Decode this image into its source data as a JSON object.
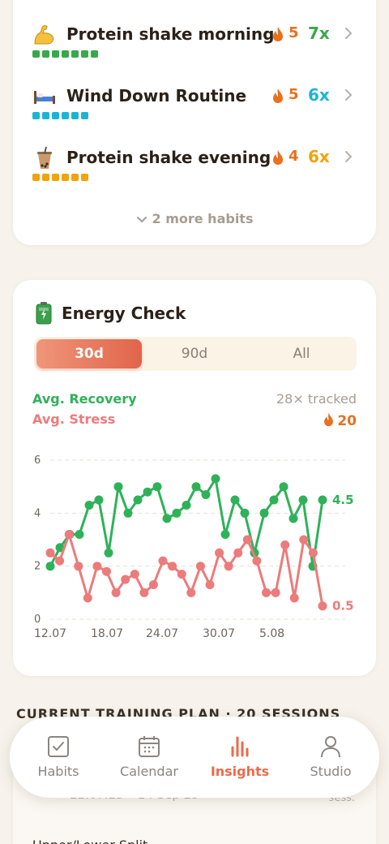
{
  "habits": [
    {
      "emoji": "flexed-biceps-icon",
      "title": "Protein shake morning",
      "streak": "5",
      "count": "7x",
      "color": "#37a94a",
      "dots": 7
    },
    {
      "emoji": "bed-icon",
      "title": "Wind Down Routine",
      "streak": "5",
      "count": "6x",
      "color": "#1ab5d6",
      "dots": 6
    },
    {
      "emoji": "bubble-tea-icon",
      "title": "Protein shake evening",
      "streak": "4",
      "count": "6x",
      "color": "#f2a20a",
      "dots": 6
    }
  ],
  "more_habits": "2 more habits",
  "energy": {
    "icon": "battery-icon",
    "title": "Energy Check",
    "tabs": [
      "30d",
      "90d",
      "All"
    ],
    "active_tab": "30d",
    "recovery_label": "Avg. Recovery",
    "stress_label": "Avg. Stress",
    "tracked": "28× tracked",
    "stress_streak": "20"
  },
  "chart_data": {
    "type": "line",
    "ylim": [
      0,
      6
    ],
    "yticks": [
      "0",
      "2",
      "4",
      "6"
    ],
    "xticks": [
      "12.07",
      "18.07",
      "24.07",
      "30.07",
      "5.08"
    ],
    "grid": true,
    "series": [
      {
        "name": "Avg. Recovery",
        "color": "#2fb15a",
        "end_label": "4.5",
        "values": [
          2.0,
          2.7,
          3.2,
          3.2,
          4.3,
          4.5,
          2.5,
          5.0,
          4.0,
          4.5,
          4.8,
          5.0,
          3.8,
          4.0,
          4.3,
          5.0,
          4.7,
          5.3,
          3.2,
          4.5,
          4.0,
          2.5,
          4.0,
          4.5,
          5.0,
          3.8,
          4.5,
          2.0,
          4.5
        ]
      },
      {
        "name": "Avg. Stress",
        "color": "#ec7b7b",
        "end_label": "0.5",
        "values": [
          2.5,
          2.2,
          3.2,
          2.0,
          0.8,
          2.0,
          1.8,
          1.0,
          1.5,
          1.7,
          1.0,
          1.3,
          2.2,
          2.0,
          1.7,
          1.0,
          2.0,
          1.3,
          2.5,
          2.0,
          2.5,
          3.0,
          2.2,
          1.0,
          1.0,
          2.8,
          0.8,
          3.0,
          2.5,
          0.5
        ]
      }
    ]
  },
  "plan": {
    "heading": "CURRENT TRAINING PLAN · 20 SESSIONS",
    "date_range": "22.07.25 – 14 Sep 25",
    "sess": "sess.",
    "row2": "Upper/Lower Split"
  },
  "tabbar": [
    {
      "label": "Habits",
      "icon": "checkbox-icon",
      "active": false
    },
    {
      "label": "Calendar",
      "icon": "calendar-icon",
      "active": false
    },
    {
      "label": "Insights",
      "icon": "bar-chart-icon",
      "active": true
    },
    {
      "label": "Studio",
      "icon": "person-icon",
      "active": false
    }
  ],
  "colors": {
    "accent": "#ec6a4a",
    "flame": "#e8701e",
    "recovery": "#2fb15a",
    "stress": "#ec7b7b",
    "background": "#f7f3ec"
  }
}
